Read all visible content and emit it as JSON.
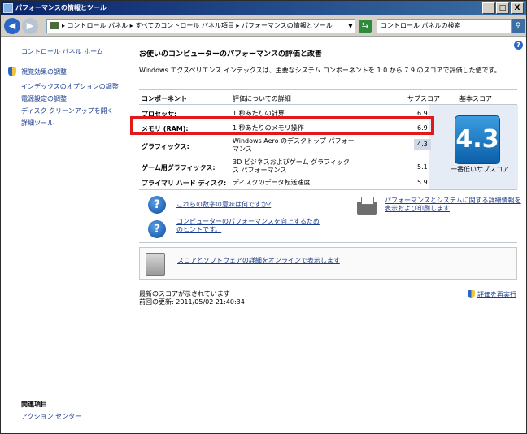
{
  "window": {
    "title": "パフォーマンスの情報とツール",
    "controls": {
      "minimize": "_",
      "maximize": "□",
      "close": "X"
    }
  },
  "address": {
    "path": "▸ コントロール パネル ▸ すべてのコントロール パネル項目 ▸ パフォーマンスの情報とツール",
    "search_placeholder": "コントロール パネルの検索"
  },
  "sidebar": {
    "home": "コントロール パネル ホーム",
    "items": [
      {
        "label": "視覚効果の調整"
      },
      {
        "label": "インデックスのオプションの調整"
      },
      {
        "label": "電源設定の調整"
      },
      {
        "label": "ディスク クリーンアップを開く"
      },
      {
        "label": "詳細ツール"
      }
    ],
    "related_title": "関連項目",
    "related_items": [
      {
        "label": "アクション センター"
      }
    ]
  },
  "main": {
    "heading": "お使いのコンピューターのパフォーマンスの評価と改善",
    "description": "Windows エクスペリエンス インデックスは、主要なシステム コンポーネントを 1.0 から 7.9 のスコアで評価した値です。",
    "columns": {
      "component": "コンポーネント",
      "detail": "評価についての詳細",
      "subscore": "サブスコア",
      "base_score": "基本スコア"
    },
    "rows": [
      {
        "component": "プロセッサ:",
        "detail": "1 秒あたりの計算",
        "subscore": "6.9"
      },
      {
        "component": "メモリ (RAM):",
        "detail": "1 秒あたりのメモリ操作",
        "subscore": "6.9"
      },
      {
        "component": "グラフィックス:",
        "detail": "Windows Aero のデスクトップ パフォーマンス",
        "subscore": "4.3"
      },
      {
        "component": "ゲーム用グラフィックス:",
        "detail": "3D ビジネスおよびゲーム グラフィックス パフォーマンス",
        "subscore": "5.1"
      },
      {
        "component": "プライマリ ハード ディスク:",
        "detail": "ディスクのデータ転送速度",
        "subscore": "5.9"
      }
    ],
    "base_score": "4.3",
    "base_score_caption": "一番低いサブスコア",
    "links": {
      "meaning": "これらの数字の意味は何ですか?",
      "tips": "コンピューターのパフォーマンスを向上するためのヒントです。",
      "print": "パフォーマンスとシステムに関する詳細情報を表示および印刷します",
      "online": "スコアとソフトウェアの詳細をオンラインで表示します"
    },
    "status_line1": "最新のスコアが示されています",
    "status_line2": "前回の更新: 2011/05/02 21:40:34",
    "rerun": "評価を再実行"
  },
  "colors": {
    "highlight_border": "#e01a1a",
    "badge": "#0b5fa8",
    "link": "#1a3c8c"
  }
}
